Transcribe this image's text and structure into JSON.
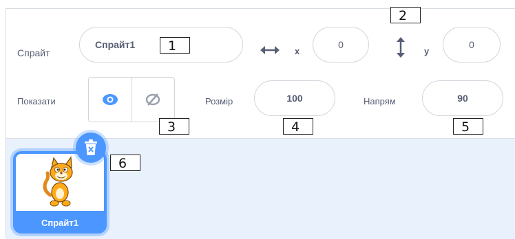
{
  "sprite_info": {
    "sprite_label": "Спрайт",
    "sprite_name_value": "Спрайт1",
    "x_label": "x",
    "x_value": "0",
    "y_label": "y",
    "y_value": "0",
    "show_label": "Показати",
    "size_label": "Розмір",
    "size_value": "100",
    "direction_label": "Напрям",
    "direction_value": "90"
  },
  "sprite_list": {
    "items": [
      {
        "name": "Спрайт1",
        "thumbnail_icon": "cat-sprite-icon"
      }
    ],
    "delete_icon": "trash-icon"
  },
  "callouts": [
    "1",
    "2",
    "3",
    "4",
    "5",
    "6"
  ],
  "colors": {
    "accent": "#4c97ff",
    "text": "#575e75",
    "sprite_area_bg": "#e9f1fc",
    "border": "#d0d5dc"
  },
  "icons": {
    "x_arrow": "horizontal-arrows-icon",
    "y_arrow": "vertical-arrows-icon",
    "show": "eye-icon",
    "hide": "eye-hidden-icon"
  }
}
